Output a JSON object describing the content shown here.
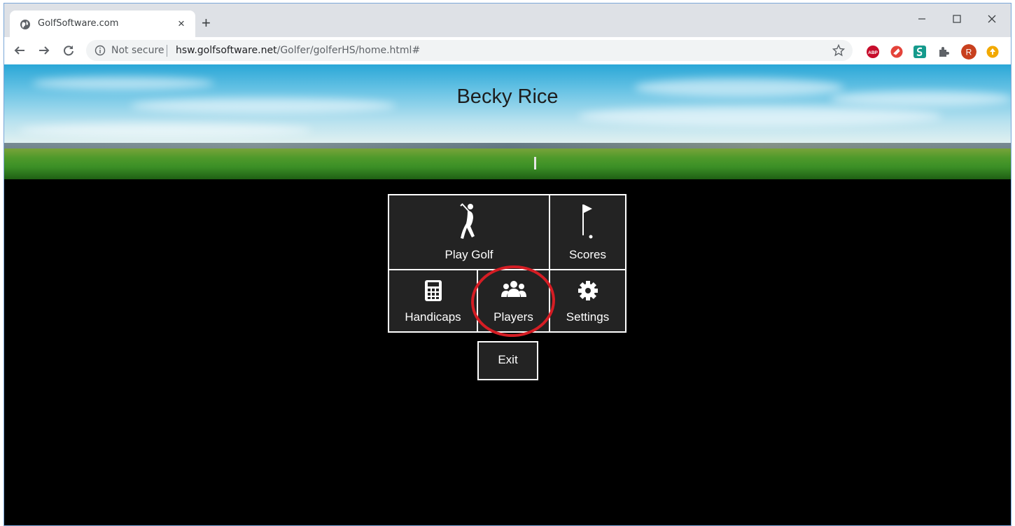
{
  "browser": {
    "tab_title": "GolfSoftware.com",
    "tab_close": "×",
    "new_tab": "+",
    "not_secure": "Not secure",
    "url_host": "hsw.golfsoftware.net",
    "url_path": "/Golfer/golferHS/home.html#",
    "extensions": [
      "abp-icon",
      "ext-red-icon",
      "ext-green-s-icon",
      "puzzle-icon",
      "profile-avatar",
      "update-icon"
    ],
    "profile_initial": "R",
    "abp_label": "ABP"
  },
  "page": {
    "player_name": "Becky Rice",
    "menu": {
      "play_golf": "Play Golf",
      "scores": "Scores",
      "handicaps": "Handicaps",
      "players": "Players",
      "settings": "Settings",
      "exit": "Exit"
    },
    "highlight_color": "#d51d24"
  }
}
